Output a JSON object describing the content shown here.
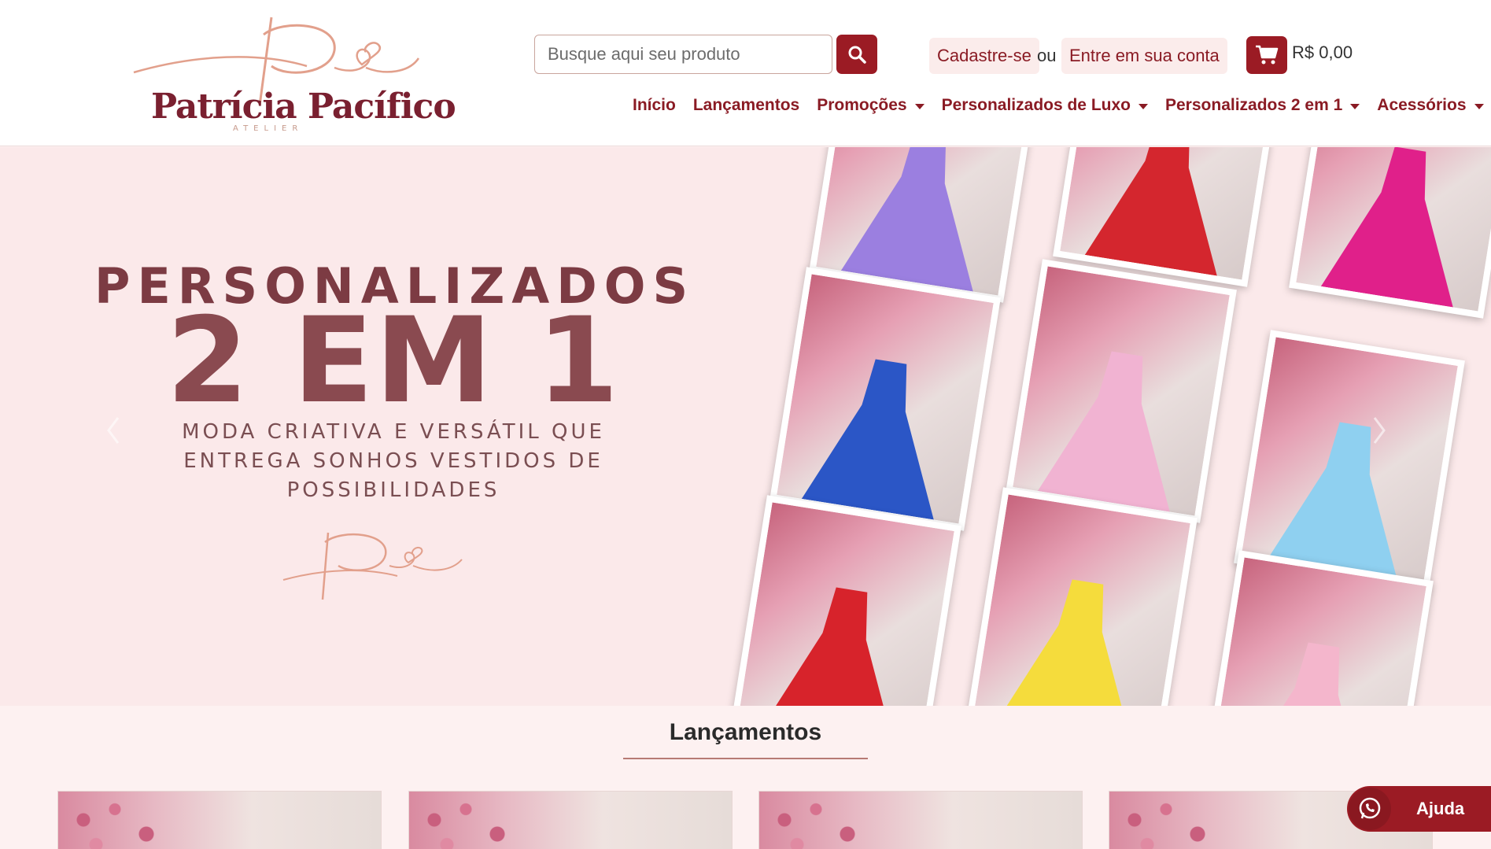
{
  "brand": {
    "name": "Patrícia Pacífico",
    "subtitle": "ATELIER",
    "accent_color": "#9b1b24",
    "logo_color": "#7a2030",
    "script_color": "#e2a08c"
  },
  "header": {
    "search": {
      "placeholder": "Busque aqui seu produto",
      "icon": "search-icon"
    },
    "account": {
      "signup_label": "Cadastre-se",
      "separator": "ou",
      "login_label": "Entre em sua conta"
    },
    "cart": {
      "icon": "cart-icon",
      "total": "R$ 0,00"
    }
  },
  "nav": {
    "items": [
      {
        "label": "Início",
        "dropdown": false
      },
      {
        "label": "Lançamentos",
        "dropdown": false
      },
      {
        "label": "Promoções",
        "dropdown": true
      },
      {
        "label": "Personalizados de Luxo",
        "dropdown": true
      },
      {
        "label": "Personalizados 2 em 1",
        "dropdown": true
      },
      {
        "label": "Acessórios",
        "dropdown": true
      }
    ]
  },
  "hero": {
    "line1": "PERSONALIZADOS",
    "line2": "2 EM 1",
    "subtitle": "MODA CRIATIVA E VERSÁTIL QUE ENTREGA SONHOS VESTIDOS DE POSSIBILIDADES",
    "prev_icon": "chevron-left-icon",
    "next_icon": "chevron-right-icon",
    "photo_dress_colors": [
      "#9b7fe0",
      "#d4262e",
      "#e0208a",
      "#2b56c6",
      "#f1b3d2",
      "#8fd0f0",
      "#d7232b",
      "#f5dc3c",
      "#f4b6cc"
    ]
  },
  "launches": {
    "title": "Lançamentos",
    "cards": [
      {
        "name": "product-card-1"
      },
      {
        "name": "product-card-2"
      },
      {
        "name": "product-card-3"
      },
      {
        "name": "product-card-4"
      }
    ]
  },
  "help": {
    "label": "Ajuda",
    "icon": "whatsapp-icon"
  }
}
